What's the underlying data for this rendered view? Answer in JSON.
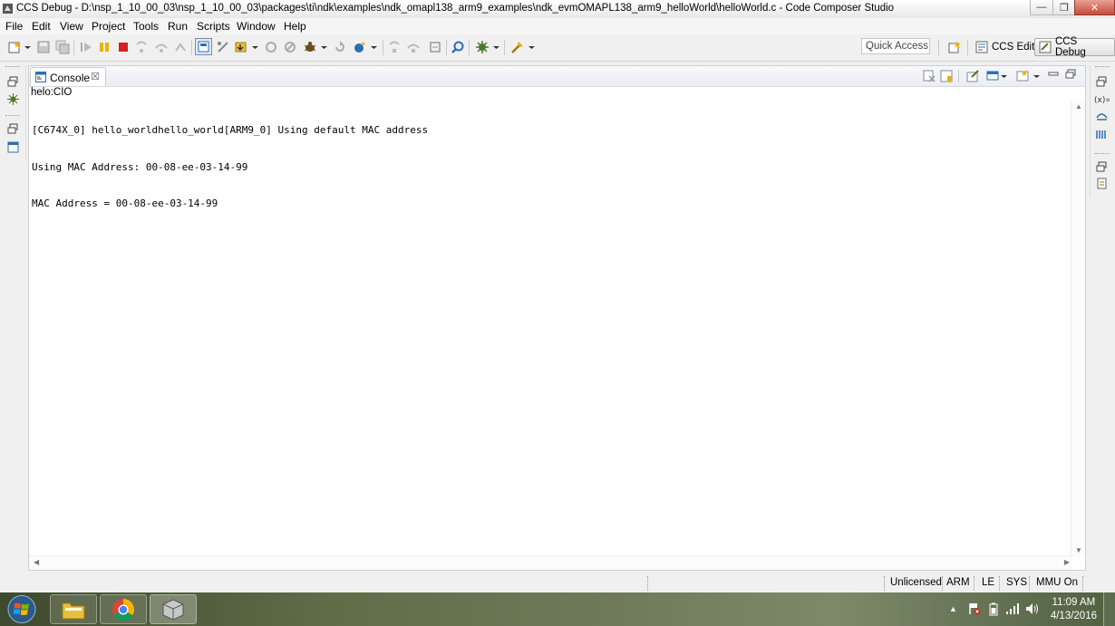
{
  "window": {
    "title": "CCS Debug - D:\\nsp_1_10_00_03\\nsp_1_10_00_03\\packages\\ti\\ndk\\examples\\ndk_omapl138_arm9_examples\\ndk_evmOMAPL138_arm9_helloWorld\\helloWorld.c - Code Composer Studio",
    "minimize_glyph": "—",
    "maximize_glyph": "❐",
    "close_glyph": "✕"
  },
  "menu": {
    "items": [
      "File",
      "Edit",
      "View",
      "Project",
      "Tools",
      "Run",
      "Scripts",
      "Window",
      "Help"
    ]
  },
  "toolbar": {
    "quick_access_placeholder": "Quick Access",
    "perspectives": [
      "CCS Edit",
      "CCS Debug"
    ]
  },
  "console": {
    "tab_label": "Console",
    "tab_close": "☒",
    "name": "helo:CIO",
    "lines": [
      "[C674X_0] hello_worldhello_world[ARM9_0] Using default MAC address",
      "Using MAC Address: 00-08-ee-03-14-99",
      "MAC Address = 00-08-ee-03-14-99"
    ]
  },
  "statusbar": {
    "items": [
      "Unlicensed",
      "ARM",
      "LE",
      "SYS",
      "MMU On"
    ]
  },
  "taskbar": {
    "time": "11:09 AM",
    "date": "4/13/2016"
  },
  "colors": {
    "accent": "#2a6fb5",
    "stop_red": "#d42020",
    "suspend_yellow": "#e8b10f"
  }
}
